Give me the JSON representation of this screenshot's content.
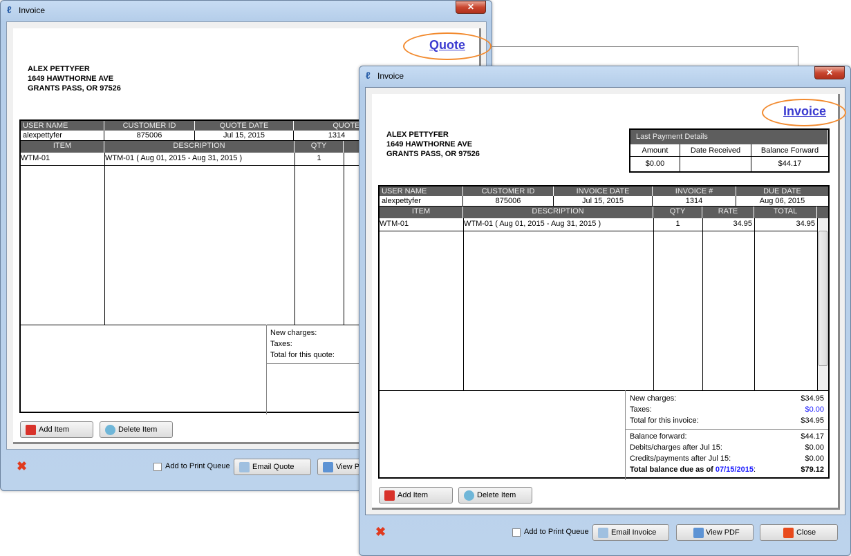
{
  "quote_window": {
    "title": "Invoice",
    "doc_type": "Quote",
    "address": [
      "ALEX PETTYFER",
      "1649 HAWTHORNE AVE",
      "GRANTS PASS, OR 97526"
    ],
    "info_headers": [
      "USER NAME",
      "CUSTOMER ID",
      "QUOTE DATE",
      "QUOTE #"
    ],
    "info_values": [
      "alexpettyfer",
      "875006",
      "Jul 15, 2015",
      "1314"
    ],
    "item_headers": [
      "ITEM",
      "DESCRIPTION",
      "QTY"
    ],
    "items": [
      {
        "item": "WTM-01",
        "description": "WTM-01 ( Aug 01, 2015 - Aug 31, 2015 )",
        "qty": "1"
      }
    ],
    "totals_labels": [
      "New charges:",
      "Taxes:",
      "Total for this quote:"
    ],
    "buttons": {
      "add_item": "Add Item",
      "delete_item": "Delete Item",
      "print_queue": "Add to Print Queue",
      "email": "Email Quote",
      "view_pdf": "View PDF"
    }
  },
  "invoice_window": {
    "title": "Invoice",
    "doc_type": "Invoice",
    "address": [
      "ALEX PETTYFER",
      "1649 HAWTHORNE AVE",
      "GRANTS PASS, OR 97526"
    ],
    "last_payment": {
      "title": "Last Payment Details",
      "headers": [
        "Amount",
        "Date Received",
        "Balance Forward"
      ],
      "values": [
        "$0.00",
        "",
        "$44.17"
      ]
    },
    "info_headers": [
      "USER NAME",
      "CUSTOMER ID",
      "INVOICE DATE",
      "INVOICE #",
      "DUE DATE"
    ],
    "info_values": [
      "alexpettyfer",
      "875006",
      "Jul 15, 2015",
      "1314",
      "Aug 06, 2015"
    ],
    "item_headers": [
      "ITEM",
      "DESCRIPTION",
      "QTY",
      "RATE",
      "TOTAL"
    ],
    "items": [
      {
        "item": "WTM-01",
        "description": "WTM-01 ( Aug 01, 2015 - Aug 31, 2015 )",
        "qty": "1",
        "rate": "34.95",
        "total": "34.95"
      }
    ],
    "totals": [
      {
        "label": "New charges:",
        "value": "$34.95"
      },
      {
        "label": "Taxes:",
        "value": "$0.00"
      },
      {
        "label": "Total for this invoice:",
        "value": "$34.95"
      }
    ],
    "balance": [
      {
        "label": "Balance forward:",
        "value": "$44.17"
      },
      {
        "label": "Debits/charges after Jul 15:",
        "value": "$0.00"
      },
      {
        "label": "Credits/payments after Jul 15:",
        "value": "$0.00"
      }
    ],
    "total_due": {
      "label": "Total balance due as of ",
      "date": "07/15/2015",
      "colon": ":",
      "value": "$79.12"
    },
    "buttons": {
      "add_item": "Add Item",
      "delete_item": "Delete Item",
      "print_queue": "Add to Print Queue",
      "email": "Email Invoice",
      "view_pdf": "View PDF",
      "close": "Close"
    }
  },
  "colors": {
    "accent_link": "#3b3bd0",
    "highlight": "#f28a2e",
    "header_bg": "#5e5e5e",
    "blue_value": "#1a1aff"
  }
}
